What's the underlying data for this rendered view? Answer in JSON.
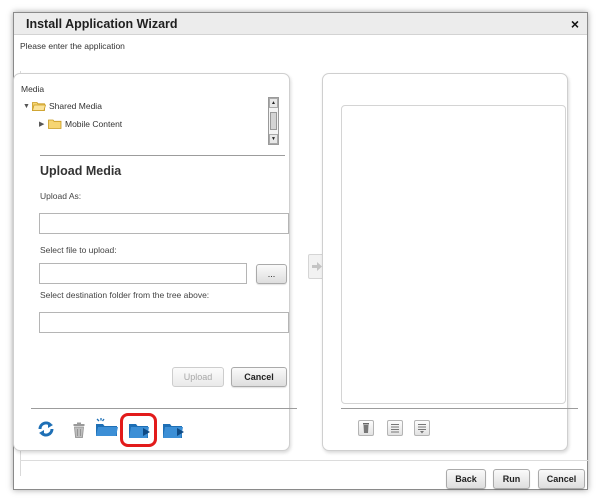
{
  "dialog": {
    "title": "Install Application Wizard",
    "close": "×",
    "subtitle": "Please enter the application"
  },
  "media": {
    "label": "Media",
    "tree": [
      {
        "label": "Shared Media",
        "expanded": true
      },
      {
        "label": "Mobile Content",
        "expanded": false
      }
    ]
  },
  "upload": {
    "heading": "Upload Media",
    "upload_as_label": "Upload As:",
    "upload_as_value": "",
    "file_label": "Select file to upload:",
    "file_value": "",
    "browse_label": "...",
    "dest_label": "Select destination folder from the tree above:",
    "dest_value": "",
    "upload_button": "Upload",
    "cancel_button": "Cancel"
  },
  "toolbar_left": {
    "icons": [
      "refresh-icon",
      "delete-icon",
      "new-folder-icon",
      "upload-folder-icon",
      "move-folder-icon"
    ]
  },
  "toolbar_right": {
    "icons": [
      "trash-icon",
      "insert-list-icon",
      "add-list-icon"
    ]
  },
  "footer": {
    "back": "Back",
    "run": "Run",
    "cancel": "Cancel"
  },
  "colors": {
    "accent_blue": "#1e6fb5",
    "highlight_red": "#e21b1b",
    "folder_yellow": "#f2c84b"
  }
}
